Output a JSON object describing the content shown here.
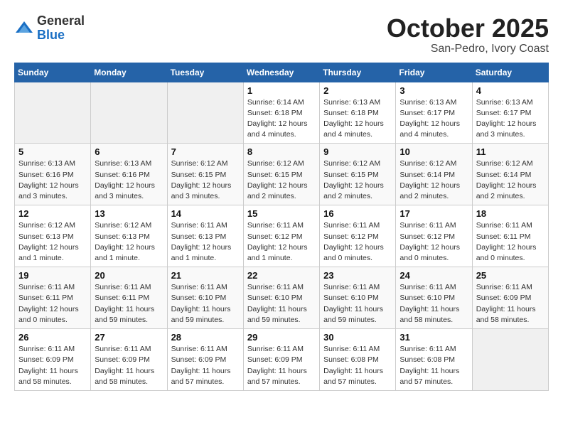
{
  "header": {
    "logo_general": "General",
    "logo_blue": "Blue",
    "month_title": "October 2025",
    "location": "San-Pedro, Ivory Coast"
  },
  "days_of_week": [
    "Sunday",
    "Monday",
    "Tuesday",
    "Wednesday",
    "Thursday",
    "Friday",
    "Saturday"
  ],
  "weeks": [
    [
      {
        "day": "",
        "info": ""
      },
      {
        "day": "",
        "info": ""
      },
      {
        "day": "",
        "info": ""
      },
      {
        "day": "1",
        "info": "Sunrise: 6:14 AM\nSunset: 6:18 PM\nDaylight: 12 hours\nand 4 minutes."
      },
      {
        "day": "2",
        "info": "Sunrise: 6:13 AM\nSunset: 6:18 PM\nDaylight: 12 hours\nand 4 minutes."
      },
      {
        "day": "3",
        "info": "Sunrise: 6:13 AM\nSunset: 6:17 PM\nDaylight: 12 hours\nand 4 minutes."
      },
      {
        "day": "4",
        "info": "Sunrise: 6:13 AM\nSunset: 6:17 PM\nDaylight: 12 hours\nand 3 minutes."
      }
    ],
    [
      {
        "day": "5",
        "info": "Sunrise: 6:13 AM\nSunset: 6:16 PM\nDaylight: 12 hours\nand 3 minutes."
      },
      {
        "day": "6",
        "info": "Sunrise: 6:13 AM\nSunset: 6:16 PM\nDaylight: 12 hours\nand 3 minutes."
      },
      {
        "day": "7",
        "info": "Sunrise: 6:12 AM\nSunset: 6:15 PM\nDaylight: 12 hours\nand 3 minutes."
      },
      {
        "day": "8",
        "info": "Sunrise: 6:12 AM\nSunset: 6:15 PM\nDaylight: 12 hours\nand 2 minutes."
      },
      {
        "day": "9",
        "info": "Sunrise: 6:12 AM\nSunset: 6:15 PM\nDaylight: 12 hours\nand 2 minutes."
      },
      {
        "day": "10",
        "info": "Sunrise: 6:12 AM\nSunset: 6:14 PM\nDaylight: 12 hours\nand 2 minutes."
      },
      {
        "day": "11",
        "info": "Sunrise: 6:12 AM\nSunset: 6:14 PM\nDaylight: 12 hours\nand 2 minutes."
      }
    ],
    [
      {
        "day": "12",
        "info": "Sunrise: 6:12 AM\nSunset: 6:13 PM\nDaylight: 12 hours\nand 1 minute."
      },
      {
        "day": "13",
        "info": "Sunrise: 6:12 AM\nSunset: 6:13 PM\nDaylight: 12 hours\nand 1 minute."
      },
      {
        "day": "14",
        "info": "Sunrise: 6:11 AM\nSunset: 6:13 PM\nDaylight: 12 hours\nand 1 minute."
      },
      {
        "day": "15",
        "info": "Sunrise: 6:11 AM\nSunset: 6:12 PM\nDaylight: 12 hours\nand 1 minute."
      },
      {
        "day": "16",
        "info": "Sunrise: 6:11 AM\nSunset: 6:12 PM\nDaylight: 12 hours\nand 0 minutes."
      },
      {
        "day": "17",
        "info": "Sunrise: 6:11 AM\nSunset: 6:12 PM\nDaylight: 12 hours\nand 0 minutes."
      },
      {
        "day": "18",
        "info": "Sunrise: 6:11 AM\nSunset: 6:11 PM\nDaylight: 12 hours\nand 0 minutes."
      }
    ],
    [
      {
        "day": "19",
        "info": "Sunrise: 6:11 AM\nSunset: 6:11 PM\nDaylight: 12 hours\nand 0 minutes."
      },
      {
        "day": "20",
        "info": "Sunrise: 6:11 AM\nSunset: 6:11 PM\nDaylight: 11 hours\nand 59 minutes."
      },
      {
        "day": "21",
        "info": "Sunrise: 6:11 AM\nSunset: 6:10 PM\nDaylight: 11 hours\nand 59 minutes."
      },
      {
        "day": "22",
        "info": "Sunrise: 6:11 AM\nSunset: 6:10 PM\nDaylight: 11 hours\nand 59 minutes."
      },
      {
        "day": "23",
        "info": "Sunrise: 6:11 AM\nSunset: 6:10 PM\nDaylight: 11 hours\nand 59 minutes."
      },
      {
        "day": "24",
        "info": "Sunrise: 6:11 AM\nSunset: 6:10 PM\nDaylight: 11 hours\nand 58 minutes."
      },
      {
        "day": "25",
        "info": "Sunrise: 6:11 AM\nSunset: 6:09 PM\nDaylight: 11 hours\nand 58 minutes."
      }
    ],
    [
      {
        "day": "26",
        "info": "Sunrise: 6:11 AM\nSunset: 6:09 PM\nDaylight: 11 hours\nand 58 minutes."
      },
      {
        "day": "27",
        "info": "Sunrise: 6:11 AM\nSunset: 6:09 PM\nDaylight: 11 hours\nand 58 minutes."
      },
      {
        "day": "28",
        "info": "Sunrise: 6:11 AM\nSunset: 6:09 PM\nDaylight: 11 hours\nand 57 minutes."
      },
      {
        "day": "29",
        "info": "Sunrise: 6:11 AM\nSunset: 6:09 PM\nDaylight: 11 hours\nand 57 minutes."
      },
      {
        "day": "30",
        "info": "Sunrise: 6:11 AM\nSunset: 6:08 PM\nDaylight: 11 hours\nand 57 minutes."
      },
      {
        "day": "31",
        "info": "Sunrise: 6:11 AM\nSunset: 6:08 PM\nDaylight: 11 hours\nand 57 minutes."
      },
      {
        "day": "",
        "info": ""
      }
    ]
  ]
}
